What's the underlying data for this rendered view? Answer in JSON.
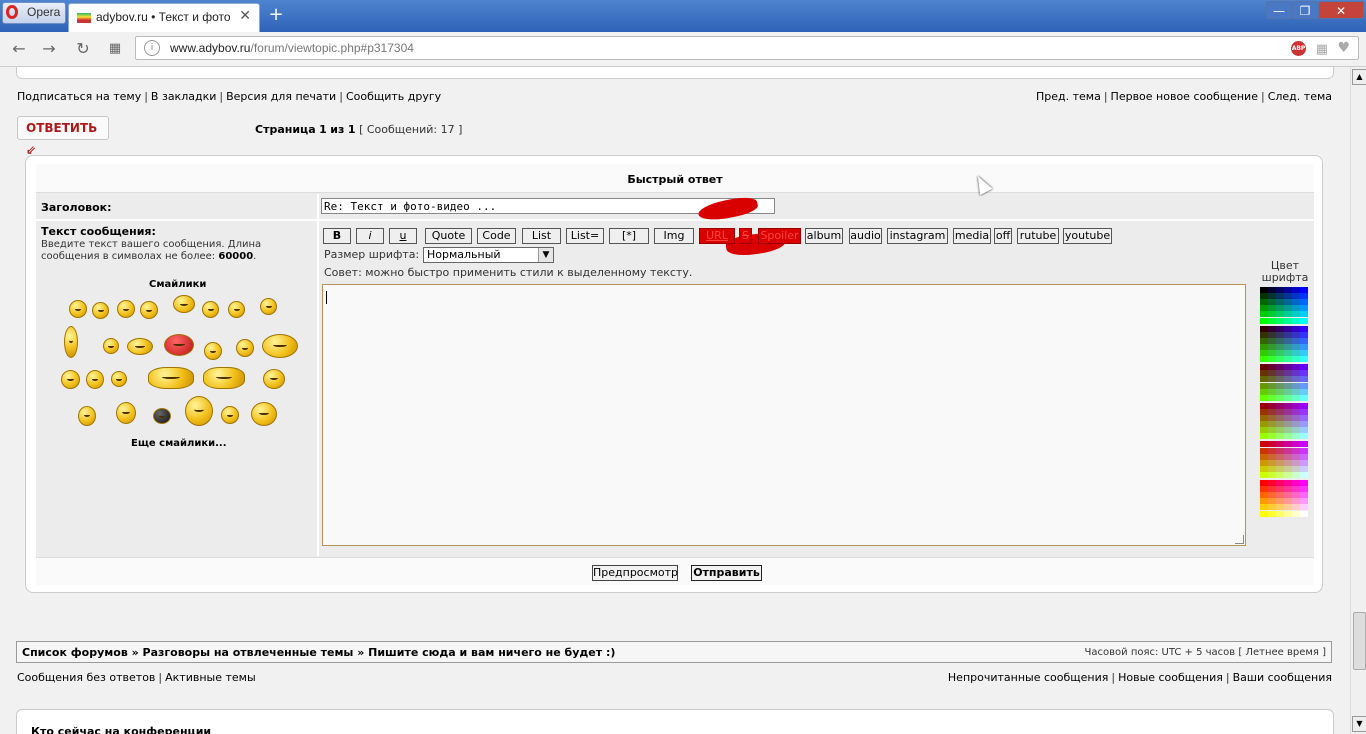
{
  "browser": {
    "menu_label": "Opera",
    "tab_title": "adybov.ru • Текст и фото",
    "url_host": "www.adybov.ru",
    "url_path": "/forum/viewtopic.php#p317304",
    "new_tab": "+",
    "win_min": "—",
    "win_max": "❐",
    "win_close": "✕"
  },
  "top_links": {
    "subscribe": "Подписаться на тему",
    "bookmarks": "В закладки",
    "print": "Версия для печати",
    "tell_friend": "Сообщить другу",
    "prev_topic": "Пред. тема",
    "first_new": "Первое новое сообщение",
    "next_topic": "След. тема"
  },
  "reply_button": "ОТВЕТИТЬ ⇙",
  "pagination": {
    "page_label": "Страница",
    "current": "1",
    "of_label": "из",
    "total": "1",
    "posts_text": "[ Сообщений: 17 ]"
  },
  "quick_reply": {
    "title": "Быстрый ответ",
    "subject_label": "Заголовок:",
    "subject_value": "Re: Текст и фото-видео ...",
    "message_label": "Текст сообщения:",
    "message_hint_pre": "Введите текст вашего сообщения. Длина сообщения в символах не более:",
    "message_limit": "60000",
    "smilies_title": "Смайлики",
    "more_smilies": "Еще смайлики...",
    "bbcode_buttons": [
      "B",
      "i",
      "u",
      "Quote",
      "Code",
      "List",
      "List=",
      "[*]",
      "Img",
      "URL",
      "S",
      "Spoiler",
      "album",
      "audio",
      "instagram",
      "media",
      "off",
      "rutube",
      "youtube"
    ],
    "fontsize_label": "Размер шрифта:",
    "fontsize_value": "Нормальный",
    "tip": "Совет: можно быстро применить стили к выделенному тексту.",
    "color_title": "Цвет шрифта",
    "preview_button": "Предпросмотр",
    "send_button": "Отправить"
  },
  "breadcrumb": {
    "path": "Список форумов » Разговоры на отвлеченные темы » Пишите сюда и вам ничего не будет :)",
    "timezone": "Часовой пояс: UTC + 5 часов [ Летнее время ]"
  },
  "bottom_links": {
    "unanswered": "Сообщения без ответов",
    "active": "Активные темы",
    "unread": "Непрочитанные сообщения",
    "new": "Новые сообщения",
    "yours": "Ваши сообщения"
  },
  "online_title": "Кто сейчас на конференции",
  "colors": {
    "reply_red": "#b01818",
    "scribble_red": "#d90000",
    "tab_blue": "#2f62b8"
  }
}
